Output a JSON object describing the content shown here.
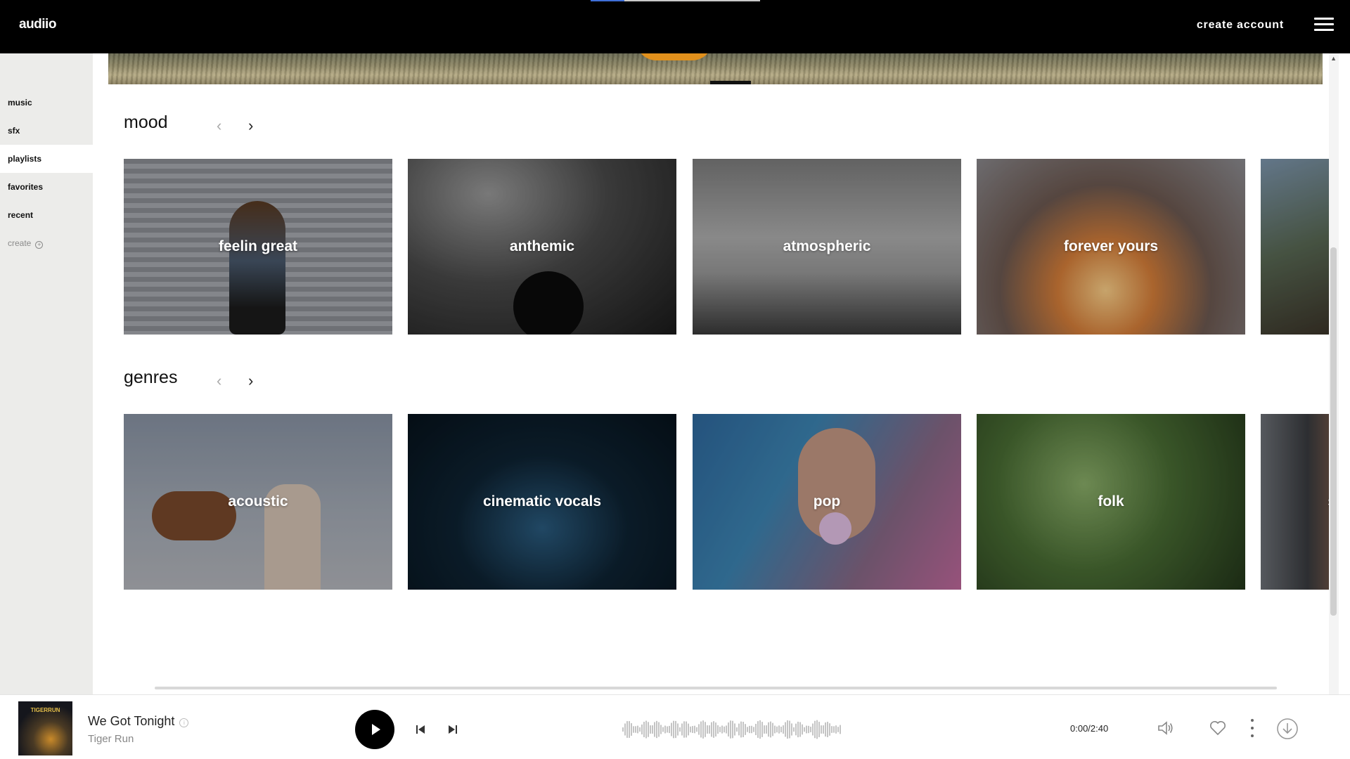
{
  "header": {
    "logo": "audiio",
    "create_account": "create account"
  },
  "sidebar": {
    "items": [
      {
        "label": "music"
      },
      {
        "label": "sfx"
      },
      {
        "label": "playlists"
      },
      {
        "label": "favorites"
      },
      {
        "label": "recent"
      },
      {
        "label": "create"
      }
    ],
    "active": "playlists"
  },
  "sections": {
    "mood": {
      "title": "mood",
      "cards": [
        "feelin great",
        "anthemic",
        "atmospheric",
        "forever yours"
      ]
    },
    "genres": {
      "title": "genres",
      "cards": [
        "acoustic",
        "cinematic vocals",
        "pop",
        "folk",
        "s"
      ]
    }
  },
  "player": {
    "cover_text": "TIGERRUN",
    "track_title": "We Got Tonight",
    "artist": "Tiger Run",
    "time": "0:00/2:40"
  },
  "icons": {
    "menu": "hamburger-icon",
    "prev": "chevron-left-icon",
    "next": "chevron-right-icon",
    "play": "play-icon",
    "skip_back": "skip-back-icon",
    "skip_forward": "skip-forward-icon",
    "volume": "volume-icon",
    "favorite": "heart-icon",
    "more": "more-vertical-icon",
    "download": "download-icon",
    "create": "plus-circle-icon"
  },
  "colors": {
    "header_bg": "#000000",
    "sidebar_bg": "#ececea",
    "accent": "#3f6fd8"
  }
}
